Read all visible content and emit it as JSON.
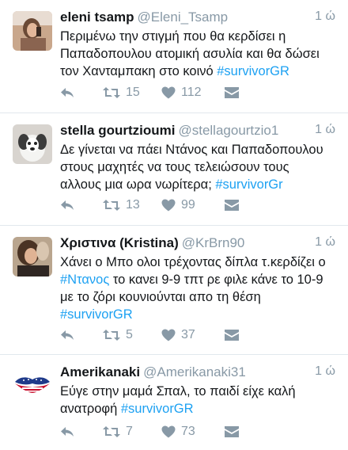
{
  "tweets": [
    {
      "name": "eleni tsamp",
      "handle": "@Eleni_Tsamp",
      "time": "1 ώ",
      "text_parts": [
        "Περιμένω την στιγμή που θα κερδίσει η\nΠαπαδοπουλου ατομική ασυλία και θα δώσει\nτον Χανταμπακη στο κοινό ",
        "#survivorGR"
      ],
      "retweets": "15",
      "likes": "112"
    },
    {
      "name": "stella gourtzioumi",
      "handle": "@stellagourtzio1",
      "time": "1 ώ",
      "text_parts": [
        "Δε γίνεται να πάει Ντάνος και Παπαδοπουλου\nστους μαχητές να τους τελειώσουν τους\nαλλους μια ωρα νωρίτερα; ",
        "#survivorGr"
      ],
      "retweets": "13",
      "likes": "99"
    },
    {
      "name": "Χριστινα (Kristina)",
      "handle": "@KrBrn90",
      "time": "1 ώ",
      "text_parts": [
        "Χάνει ο Μπο ολοι τρέχοντας δίπλα τ.κερδίζει ο\n",
        "#Ντανος",
        " το κανει 9-9 τπτ ρε φιλε κάνε το 10-9\nμε το ζόρι κουνιούνται απο τη θέση\n",
        "#survivorGR"
      ],
      "retweets": "5",
      "likes": "37"
    },
    {
      "name": "Amerikanaki",
      "handle": "@Amerikanaki31",
      "time": "1 ώ",
      "text_parts": [
        "Εύγε στην μαμά Σπαλ, το παιδί είχε καλή\nανατροφή  ",
        "#survivorGR"
      ],
      "retweets": "7",
      "likes": "73"
    }
  ],
  "icons": {
    "reply": "reply-icon",
    "retweet": "retweet-icon",
    "like": "heart-icon",
    "dm": "envelope-icon"
  },
  "colors": {
    "text": "#14171a",
    "muted": "#8899a6",
    "link": "#1da1f2",
    "divider": "#e1e8ed"
  }
}
